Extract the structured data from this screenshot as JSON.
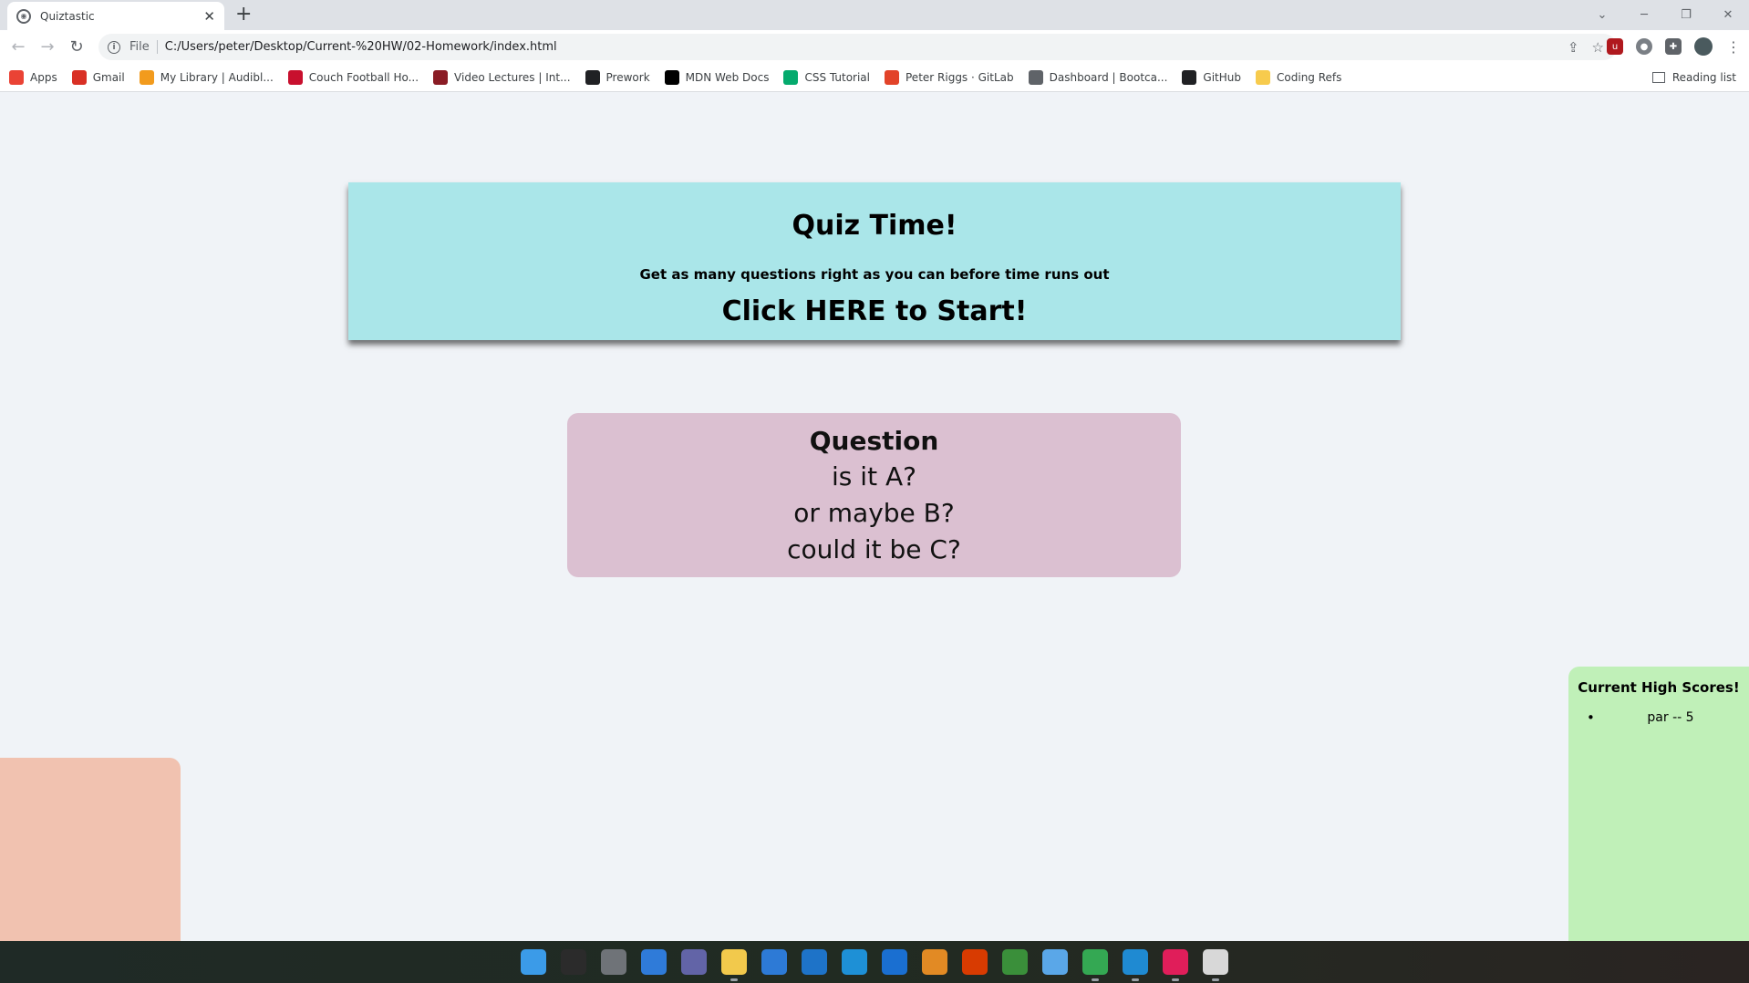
{
  "browser": {
    "tab_title": "Quiztastic",
    "new_tab": "+",
    "window_controls": [
      "⌄",
      "─",
      "❐",
      "✕"
    ],
    "address_scheme": "File",
    "address_url": "C:/Users/peter/Desktop/Current-%20HW/02-Homework/index.html",
    "bookmarks": [
      {
        "label": "Apps",
        "icon": "apps-grid-icon",
        "color": "#ea4335"
      },
      {
        "label": "Gmail",
        "icon": "gmail-icon",
        "color": "#d93025"
      },
      {
        "label": "My Library | Audibl...",
        "icon": "audible-icon",
        "color": "#f29b1d"
      },
      {
        "label": "Couch Football Ho...",
        "icon": "nfl-icon",
        "color": "#c8102e"
      },
      {
        "label": "Video Lectures | Int...",
        "icon": "mit-icon",
        "color": "#8a1c25"
      },
      {
        "label": "Prework",
        "icon": "book-icon",
        "color": "#202124"
      },
      {
        "label": "MDN Web Docs",
        "icon": "mdn-icon",
        "color": "#000000"
      },
      {
        "label": "CSS Tutorial",
        "icon": "w3schools-icon",
        "color": "#04aa6d"
      },
      {
        "label": "Peter Riggs · GitLab",
        "icon": "gitlab-icon",
        "color": "#e24329"
      },
      {
        "label": "Dashboard | Bootca...",
        "icon": "globe-icon",
        "color": "#5f6368"
      },
      {
        "label": "GitHub",
        "icon": "github-icon",
        "color": "#202124"
      },
      {
        "label": "Coding Refs",
        "icon": "folder-icon",
        "color": "#f7cb4d"
      }
    ],
    "reading_list": "Reading list"
  },
  "quiz": {
    "title": "Quiz Time!",
    "subtitle": "Get as many questions right as you can before time runs out",
    "start": "Click HERE to Start!"
  },
  "question": {
    "title": "Question",
    "answers": [
      "is it A?",
      "or maybe B?",
      "could it be C?"
    ]
  },
  "scores": {
    "title": "Current High Scores!",
    "entries": [
      "par -- 5"
    ]
  },
  "taskbar": [
    {
      "icon": "windows-start-icon",
      "color": "#3b9be8"
    },
    {
      "icon": "search-icon",
      "color": "#2b2b2b"
    },
    {
      "icon": "task-view-icon",
      "color": "#6f7378"
    },
    {
      "icon": "widgets-icon",
      "color": "#2f7bd9"
    },
    {
      "icon": "teams-chat-icon",
      "color": "#6264a7"
    },
    {
      "icon": "file-explorer-icon",
      "color": "#f2c94c"
    },
    {
      "icon": "store-icon",
      "color": "#2d7ad6"
    },
    {
      "icon": "mail-icon",
      "color": "#1e73c8"
    },
    {
      "icon": "lasso-icon",
      "color": "#1e90d6"
    },
    {
      "icon": "cortana-icon",
      "color": "#1a6fd1"
    },
    {
      "icon": "sublime-icon",
      "color": "#e28a24"
    },
    {
      "icon": "office-icon",
      "color": "#d83b01"
    },
    {
      "icon": "git-icon",
      "color": "#3a8f3a"
    },
    {
      "icon": "notepad-icon",
      "color": "#5aa7e8"
    },
    {
      "icon": "chrome-icon",
      "color": "#34a853"
    },
    {
      "icon": "vscode-icon",
      "color": "#1f8ad2"
    },
    {
      "icon": "slack-icon",
      "color": "#e01e5a"
    },
    {
      "icon": "snipping-tool-icon",
      "color": "#d8d8d8"
    }
  ]
}
